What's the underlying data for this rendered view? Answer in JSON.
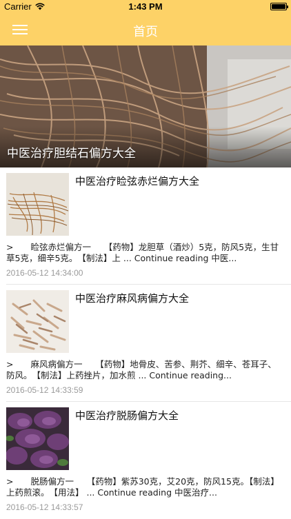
{
  "status_bar": {
    "carrier": "Carrier",
    "time": "1:43 PM"
  },
  "nav": {
    "title": "首页",
    "menu_icon": "hamburger-menu-icon"
  },
  "hero": {
    "title": "中医治疗胆结石偏方大全"
  },
  "articles": [
    {
      "title": "中医治疗睑弦赤烂偏方大全",
      "excerpt": ">　　睑弦赤烂偏方一　　【药物】龙胆草（酒炒）5克，防风5克，生甘草5克，细辛5克。　【制法】上 ... Continue reading 中医...",
      "date": "2016-05-12 14:34:00"
    },
    {
      "title": "中医治疗麻风病偏方大全",
      "excerpt": ">　　麻风病偏方一　　【药物】地骨皮、苦参、荆芥、细辛、苍耳子、防风。　【制法】上药挫片，加水煎 ... Continue reading...",
      "date": "2016-05-12 14:33:59"
    },
    {
      "title": "中医治疗脱肠偏方大全",
      "excerpt": ">　　脱肠偏方一　　【药物】紫苏30克，艾20克，防风15克。【制法】上药煎滚。　【用法】 ... Continue reading 中医治疗...",
      "date": "2016-05-12 14:33:57"
    }
  ],
  "colors": {
    "accent": "#fdd267",
    "date_text": "#9a9a9a"
  }
}
